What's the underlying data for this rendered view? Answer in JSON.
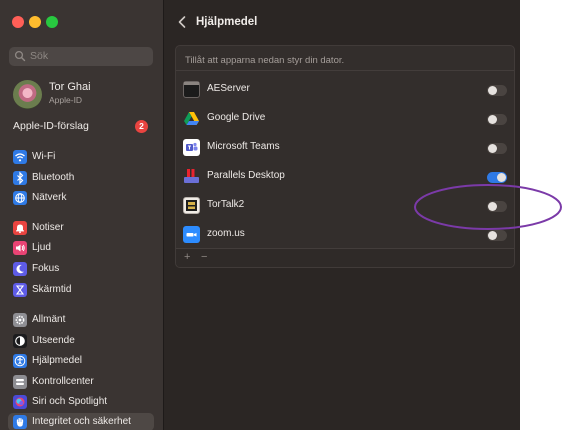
{
  "colors": {
    "annotation": "#7b3aa8",
    "toggle_on": "#2f7ae5",
    "badge": "#e94440",
    "window_close": "#ff5f57",
    "window_minimize": "#febc2e",
    "window_zoom": "#28c840"
  },
  "sidebar": {
    "search_placeholder": "Sök",
    "profile": {
      "name": "Tor Ghai",
      "subtitle": "Apple-ID"
    },
    "suggestions_label": "Apple-ID-förslag",
    "suggestions_count": "2",
    "items": [
      {
        "label": "Wi-Fi",
        "icon": "wifi-icon",
        "color": "#2f7ae5"
      },
      {
        "label": "Bluetooth",
        "icon": "bluetooth-icon",
        "color": "#2f7ae5"
      },
      {
        "label": "Nätverk",
        "icon": "globe-icon",
        "color": "#2f7ae5"
      },
      {
        "label": "Notiser",
        "icon": "bell-icon",
        "color": "#e94440"
      },
      {
        "label": "Ljud",
        "icon": "speaker-icon",
        "color": "#e94474"
      },
      {
        "label": "Fokus",
        "icon": "moon-icon",
        "color": "#5e5ce6"
      },
      {
        "label": "Skärmtid",
        "icon": "hourglass-icon",
        "color": "#5e5ce6"
      },
      {
        "label": "Allmänt",
        "icon": "gear-icon",
        "color": "#8e8e93"
      },
      {
        "label": "Utseende",
        "icon": "appearance-icon",
        "color": "#1c1c1e"
      },
      {
        "label": "Hjälpmedel",
        "icon": "accessibility-icon",
        "color": "#2f7ae5"
      },
      {
        "label": "Kontrollcenter",
        "icon": "control-center-icon",
        "color": "#8e8e93"
      },
      {
        "label": "Siri och Spotlight",
        "icon": "siri-icon",
        "color": "#4b4bd6"
      },
      {
        "label": "Integritet och säkerhet",
        "icon": "hand-icon",
        "color": "#2f7ae5",
        "selected": true
      }
    ]
  },
  "main": {
    "title": "Hjälpmedel",
    "header_text": "Tillåt att apparna nedan styr din dator.",
    "apps": [
      {
        "name": "AEServer",
        "icon": "terminal-app-icon",
        "enabled": false
      },
      {
        "name": "Google Drive",
        "icon": "google-drive-icon",
        "enabled": false
      },
      {
        "name": "Microsoft Teams",
        "icon": "teams-icon",
        "enabled": false
      },
      {
        "name": "Parallels Desktop",
        "icon": "parallels-icon",
        "enabled": true
      },
      {
        "name": "TorTalk2",
        "icon": "tortalk-icon",
        "enabled": false
      },
      {
        "name": "zoom.us",
        "icon": "zoom-icon",
        "enabled": false
      }
    ],
    "add_label": "+",
    "remove_label": "−"
  }
}
